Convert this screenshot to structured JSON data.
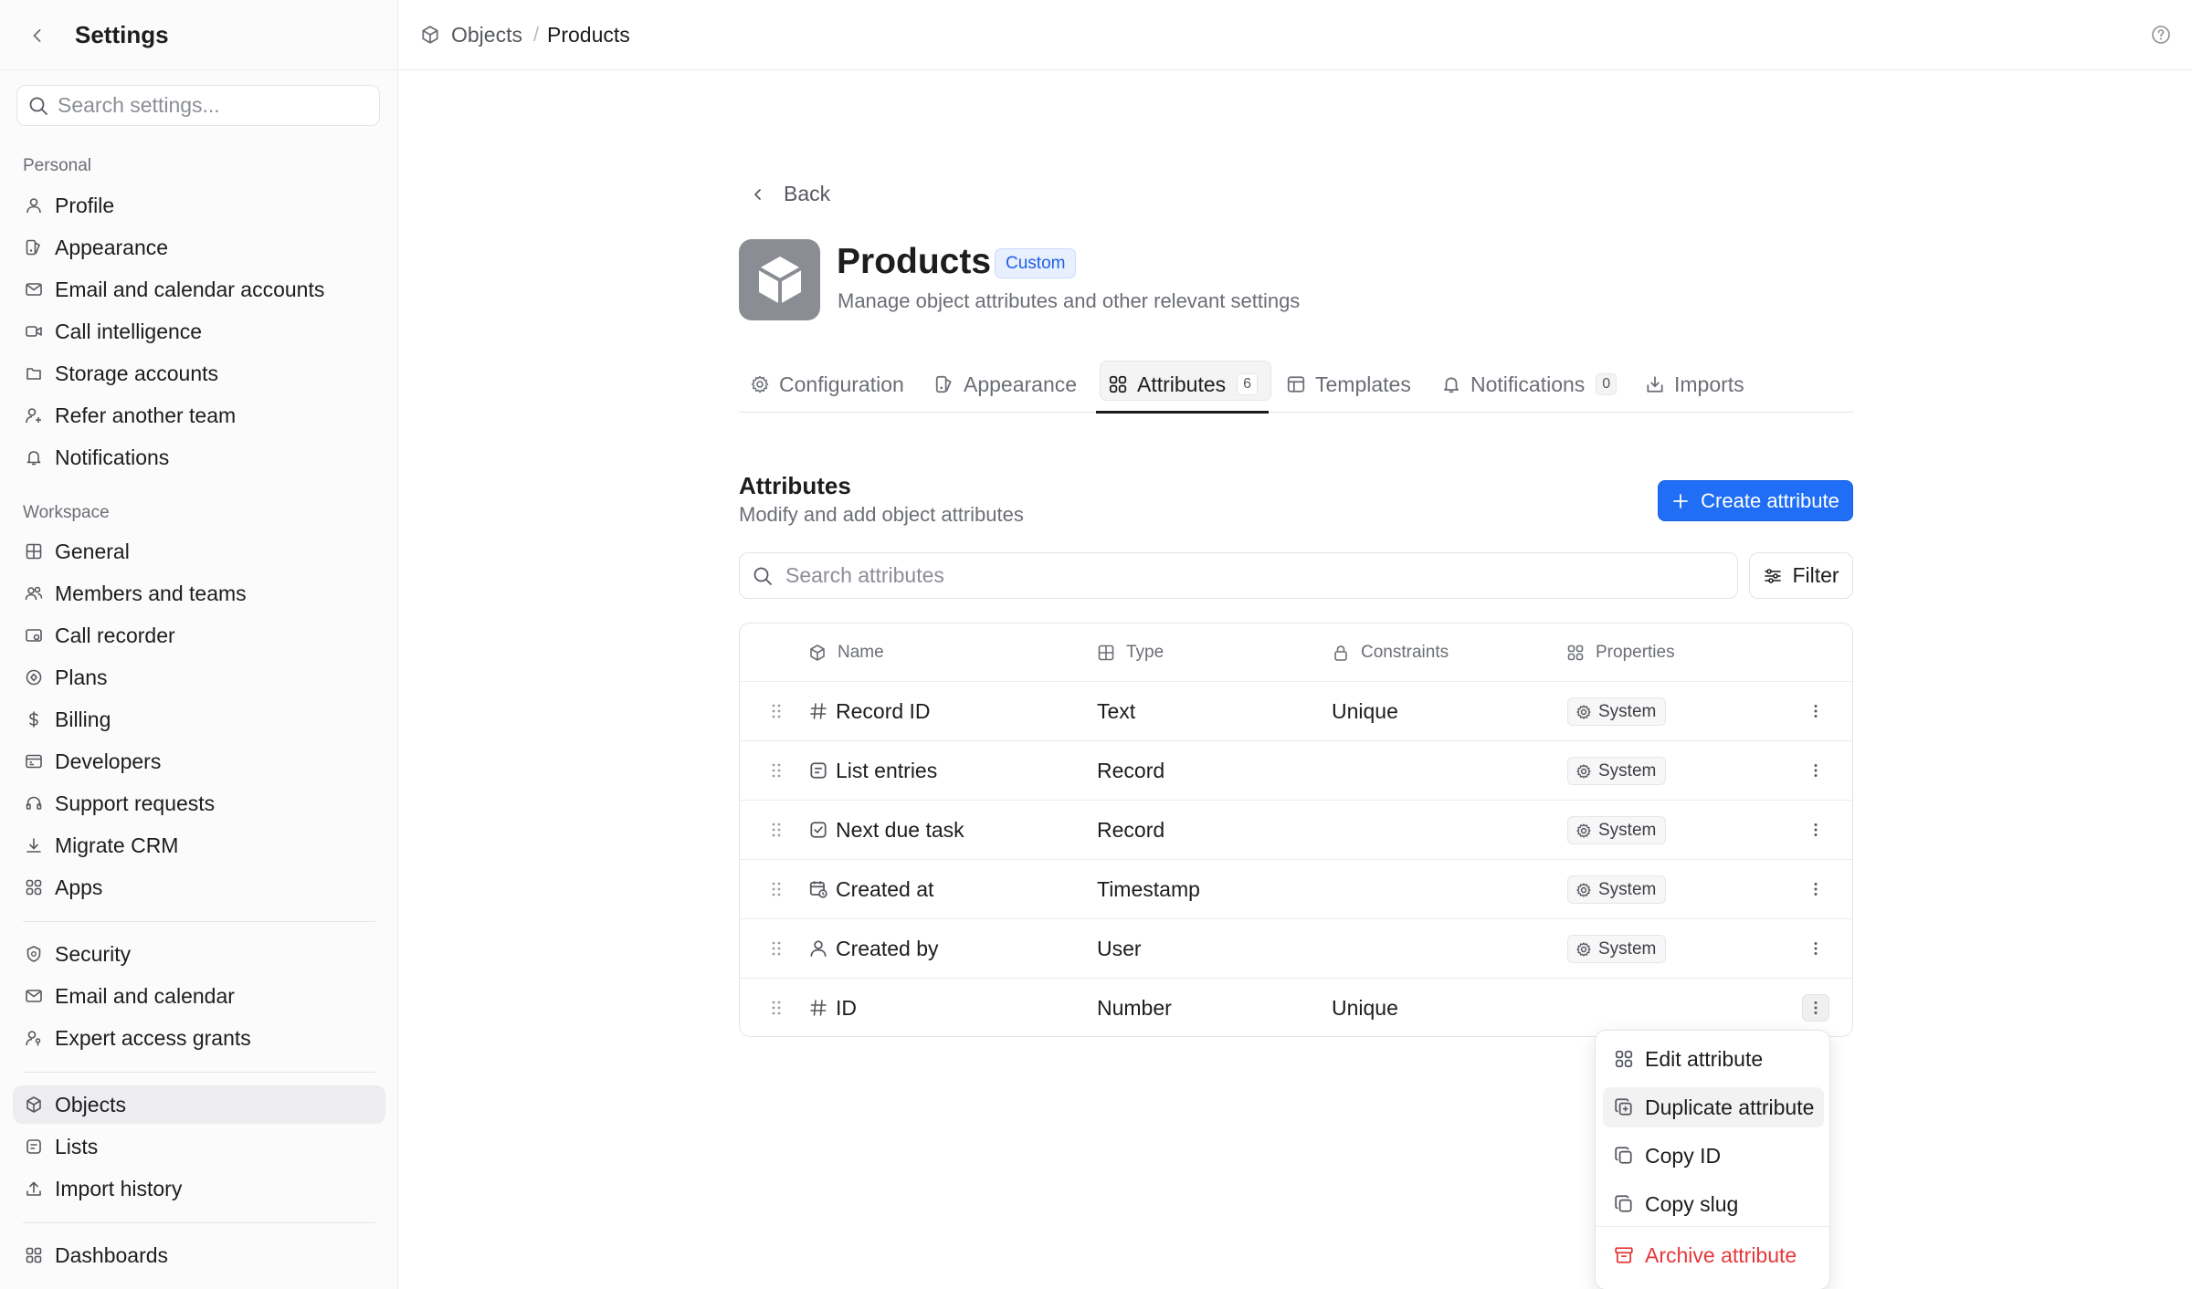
{
  "sidebar": {
    "title": "Settings",
    "search_placeholder": "Search settings...",
    "personal_label": "Personal",
    "workspace_label": "Workspace",
    "personal_items": [
      {
        "label": "Profile",
        "icon": "user-icon"
      },
      {
        "label": "Appearance",
        "icon": "palette-icon"
      },
      {
        "label": "Email and calendar accounts",
        "icon": "mail-calendar-icon"
      },
      {
        "label": "Call intelligence",
        "icon": "video-icon"
      },
      {
        "label": "Storage accounts",
        "icon": "storage-icon"
      },
      {
        "label": "Refer another team",
        "icon": "user-plus-icon"
      },
      {
        "label": "Notifications",
        "icon": "bell-icon"
      }
    ],
    "workspace_items": [
      {
        "label": "General",
        "icon": "grid-icon"
      },
      {
        "label": "Members and teams",
        "icon": "users-icon"
      },
      {
        "label": "Call recorder",
        "icon": "recorder-icon"
      },
      {
        "label": "Plans",
        "icon": "plans-icon"
      },
      {
        "label": "Billing",
        "icon": "dollar-icon"
      },
      {
        "label": "Developers",
        "icon": "terminal-icon"
      },
      {
        "label": "Support requests",
        "icon": "headset-icon"
      },
      {
        "label": "Migrate CRM",
        "icon": "download-icon"
      },
      {
        "label": "Apps",
        "icon": "apps-icon"
      }
    ],
    "security_items": [
      {
        "label": "Security",
        "icon": "shield-icon"
      },
      {
        "label": "Email and calendar",
        "icon": "envelope-icon"
      },
      {
        "label": "Expert access grants",
        "icon": "user-key-icon"
      }
    ],
    "data_items": [
      {
        "label": "Objects",
        "icon": "cube-icon",
        "active": true
      },
      {
        "label": "Lists",
        "icon": "list-icon"
      },
      {
        "label": "Import history",
        "icon": "upload-icon"
      }
    ],
    "bottom_items": [
      {
        "label": "Dashboards",
        "icon": "dashboard-icon"
      }
    ]
  },
  "breadcrumb": {
    "parent": "Objects",
    "separator": "/",
    "current": "Products"
  },
  "page": {
    "back_label": "Back",
    "title": "Products",
    "badge": "Custom",
    "subtitle": "Manage object attributes and other relevant settings"
  },
  "tabs": [
    {
      "label": "Configuration",
      "icon": "gear-icon"
    },
    {
      "label": "Appearance",
      "icon": "palette-icon"
    },
    {
      "label": "Attributes",
      "icon": "apps-icon",
      "count": "6",
      "active": true
    },
    {
      "label": "Templates",
      "icon": "template-icon"
    },
    {
      "label": "Notifications",
      "icon": "bell-icon",
      "count": "0"
    },
    {
      "label": "Imports",
      "icon": "import-icon"
    }
  ],
  "attributes": {
    "title": "Attributes",
    "subtitle": "Modify and add object attributes",
    "create_label": "Create attribute",
    "search_placeholder": "Search attributes",
    "filter_label": "Filter",
    "columns": {
      "name": "Name",
      "type": "Type",
      "constraints": "Constraints",
      "properties": "Properties"
    },
    "rows": [
      {
        "name": "Record ID",
        "icon": "hash-icon",
        "type": "Text",
        "constraints": "Unique",
        "property": "System"
      },
      {
        "name": "List entries",
        "icon": "list-entries-icon",
        "type": "Record",
        "constraints": "",
        "property": "System"
      },
      {
        "name": "Next due task",
        "icon": "checkbox-icon",
        "type": "Record",
        "constraints": "",
        "property": "System"
      },
      {
        "name": "Created at",
        "icon": "calendar-clock-icon",
        "type": "Timestamp",
        "constraints": "",
        "property": "System"
      },
      {
        "name": "Created by",
        "icon": "user-icon",
        "type": "User",
        "constraints": "",
        "property": "System"
      },
      {
        "name": "ID",
        "icon": "hash-icon",
        "type": "Number",
        "constraints": "Unique",
        "property": ""
      }
    ]
  },
  "menu": {
    "items": [
      {
        "label": "Edit attribute",
        "icon": "apps-icon"
      },
      {
        "label": "Duplicate attribute",
        "icon": "duplicate-icon",
        "hover": true
      },
      {
        "label": "Copy ID",
        "icon": "copy-icon"
      },
      {
        "label": "Copy slug",
        "icon": "copy-icon"
      }
    ],
    "danger_item": {
      "label": "Archive attribute",
      "icon": "archive-icon"
    }
  },
  "colors": {
    "accent": "#1f6ef5",
    "danger": "#e5383b",
    "badge_text": "#1f5ee6"
  }
}
